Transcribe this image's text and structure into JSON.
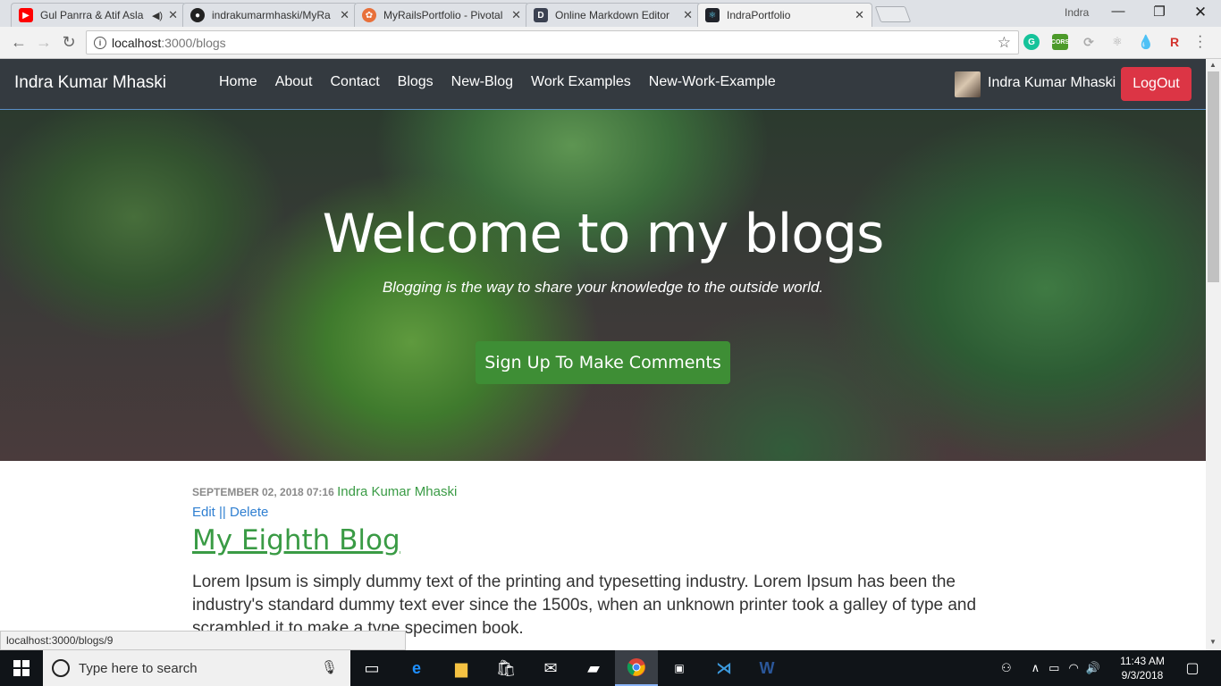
{
  "browser": {
    "tabs": [
      {
        "title": "Gul Panrra & Atif Asla",
        "favicon": "youtube-icon",
        "color": "#ff0000",
        "audio": true
      },
      {
        "title": "indrakumarmhaski/MyRa",
        "favicon": "github-icon",
        "color": "#222222"
      },
      {
        "title": "MyRailsPortfolio - Pivotal",
        "favicon": "pivotal-icon",
        "color": "#e8703a"
      },
      {
        "title": "Online Markdown Editor",
        "favicon": "dillinger-icon",
        "color": "#3b4151"
      },
      {
        "title": "IndraPortfolio",
        "favicon": "react-icon",
        "color": "#61dafb"
      }
    ],
    "profile_name": "Indra",
    "url_host": "localhost",
    "url_path": ":3000/blogs",
    "status_url": "localhost:3000/blogs/9"
  },
  "site": {
    "brand": "Indra Kumar Mhaski",
    "nav": [
      "Home",
      "About",
      "Contact",
      "Blogs",
      "New-Blog",
      "Work Examples",
      "New-Work-Example"
    ],
    "user_name": "Indra Kumar Mhaski",
    "logout_label": "LogOut"
  },
  "hero": {
    "title": "Welcome to my blogs",
    "tagline": "Blogging is the way to share your knowledge to the outside world.",
    "cta": "Sign Up To Make Comments"
  },
  "post": {
    "date": "SEPTEMBER 02, 2018 07:16",
    "author": "Indra Kumar Mhaski",
    "edit_label": "Edit",
    "separator": "||",
    "delete_label": "Delete",
    "title": "My Eighth Blog",
    "body": "Lorem Ipsum is simply dummy text of the printing and typesetting industry. Lorem Ipsum has been the industry's standard dummy text ever since the 1500s, when an unknown printer took a galley of type and scrambled it to make a type specimen book."
  },
  "taskbar": {
    "search_placeholder": "Type here to search",
    "time": "11:43 AM",
    "date": "9/3/2018"
  }
}
